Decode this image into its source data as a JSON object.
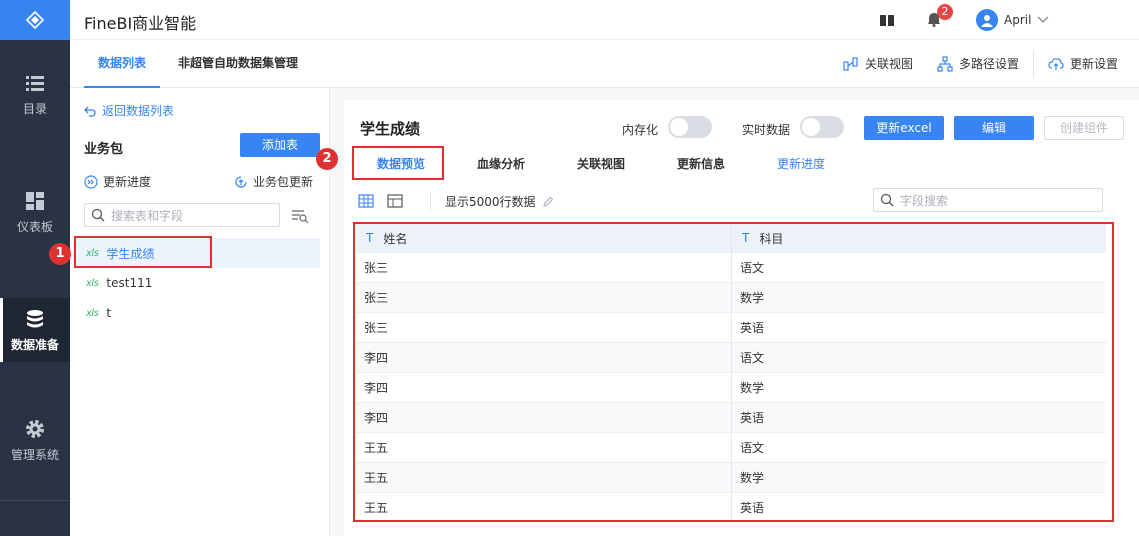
{
  "app": {
    "title": "FineBI商业智能"
  },
  "header": {
    "notifications_count": "2",
    "user_name": "April"
  },
  "left_nav": {
    "items": [
      {
        "label": "目录",
        "icon": "list-icon"
      },
      {
        "label": "仪表板",
        "icon": "dashboard-icon"
      },
      {
        "label": "数据准备",
        "icon": "database-icon",
        "active": true
      },
      {
        "label": "管理系统",
        "icon": "gear-icon"
      }
    ]
  },
  "sub_tabs": [
    {
      "label": "数据列表",
      "active": true
    },
    {
      "label": "非超管自助数据集管理"
    }
  ],
  "sub_actions": {
    "relation_view": "关联视图",
    "multipath": "多路径设置",
    "update_settings": "更新设置"
  },
  "left_panel": {
    "back_label": "返回数据列表",
    "package_title": "业务包",
    "add_table_label": "添加表",
    "update_progress_label": "更新进度",
    "package_update_label": "业务包更新",
    "search_placeholder": "搜索表和字段",
    "tables": [
      {
        "name": "学生成绩",
        "type": "xls"
      },
      {
        "name": "test111",
        "type": "xls"
      },
      {
        "name": "t",
        "type": "xls"
      }
    ]
  },
  "annotations": {
    "badge_1": "1",
    "badge_2": "2"
  },
  "main": {
    "title": "学生成绩",
    "in_memory_label": "内存化",
    "realtime_label": "实时数据",
    "update_excel_label": "更新excel",
    "edit_label": "编辑",
    "create_component_label": "创建组件",
    "tabs": [
      {
        "label": "数据预览",
        "active": true
      },
      {
        "label": "血缘分析"
      },
      {
        "label": "关联视图"
      },
      {
        "label": "更新信息"
      },
      {
        "label": "更新进度",
        "link": true
      }
    ],
    "rowcount_label": "显示5000行数据",
    "field_search_placeholder": "字段搜索",
    "columns": [
      {
        "type": "T",
        "name": "姓名"
      },
      {
        "type": "T",
        "name": "科目"
      }
    ],
    "rows": [
      [
        "张三",
        "语文"
      ],
      [
        "张三",
        "数学"
      ],
      [
        "张三",
        "英语"
      ],
      [
        "李四",
        "语文"
      ],
      [
        "李四",
        "数学"
      ],
      [
        "李四",
        "英语"
      ],
      [
        "王五",
        "语文"
      ],
      [
        "王五",
        "数学"
      ],
      [
        "王五",
        "英语"
      ]
    ]
  },
  "colors": {
    "accent": "#3685f2",
    "nav_bg": "#2a3343",
    "highlight_red": "#e03131",
    "xls_green": "#3cb371"
  }
}
